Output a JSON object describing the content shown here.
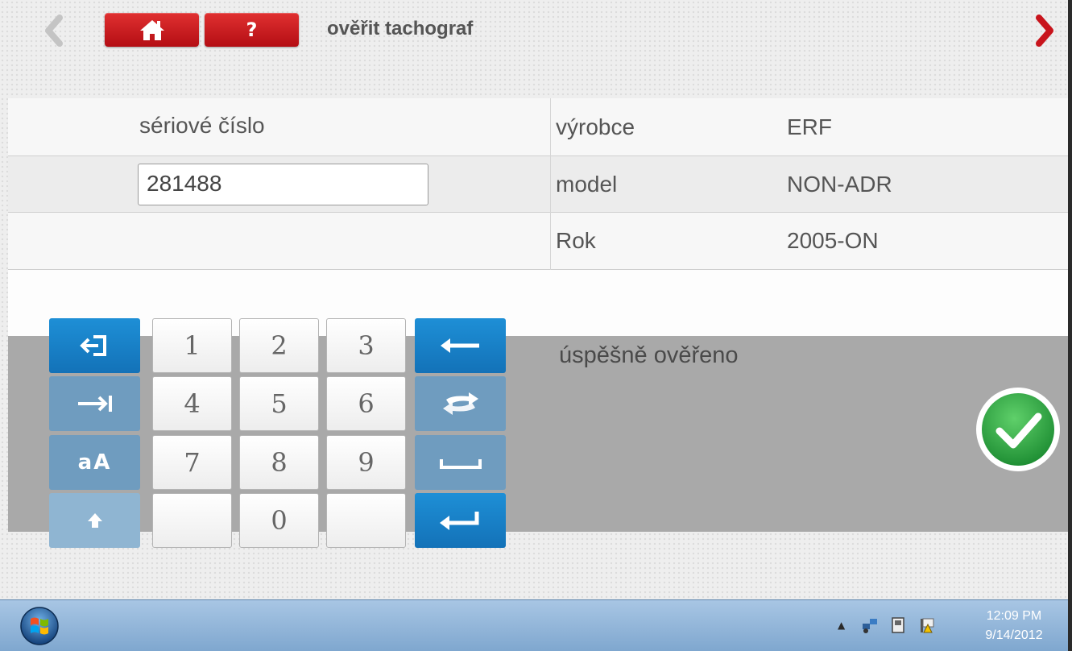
{
  "header": {
    "title": "ověřit tachograf",
    "home_icon": "home-icon",
    "help_label": "?",
    "back_icon": "chevron-left-icon",
    "next_icon": "chevron-right-icon"
  },
  "serial": {
    "label": "sériové číslo",
    "value": "281488"
  },
  "vehicle_info": [
    {
      "label": "výrobce",
      "value": "ERF"
    },
    {
      "label": "model",
      "value": "NON-ADR"
    },
    {
      "label": "Rok",
      "value": "2005-ON"
    }
  ],
  "status": {
    "message": "úspěšně ověřeno",
    "icon": "check-circle-icon",
    "color": "#2ea043"
  },
  "keypad": {
    "digits": [
      "1",
      "2",
      "3",
      "4",
      "5",
      "6",
      "7",
      "8",
      "9",
      "0"
    ],
    "case_toggle_label": "aA",
    "left_icons": [
      "exit-icon",
      "tab-icon",
      "case-icon",
      "shift-icon"
    ],
    "right_icons": [
      "backspace-icon",
      "swap-icon",
      "space-icon",
      "enter-icon"
    ]
  },
  "taskbar": {
    "time": "12:09 PM",
    "date": "9/14/2012",
    "tray_icons": [
      "network-icon",
      "card-icon",
      "flag-icon"
    ]
  },
  "colors": {
    "accent_red": "#c8141c",
    "keypad_blue": "#1a82c9",
    "status_bg": "#a9a9a9"
  }
}
